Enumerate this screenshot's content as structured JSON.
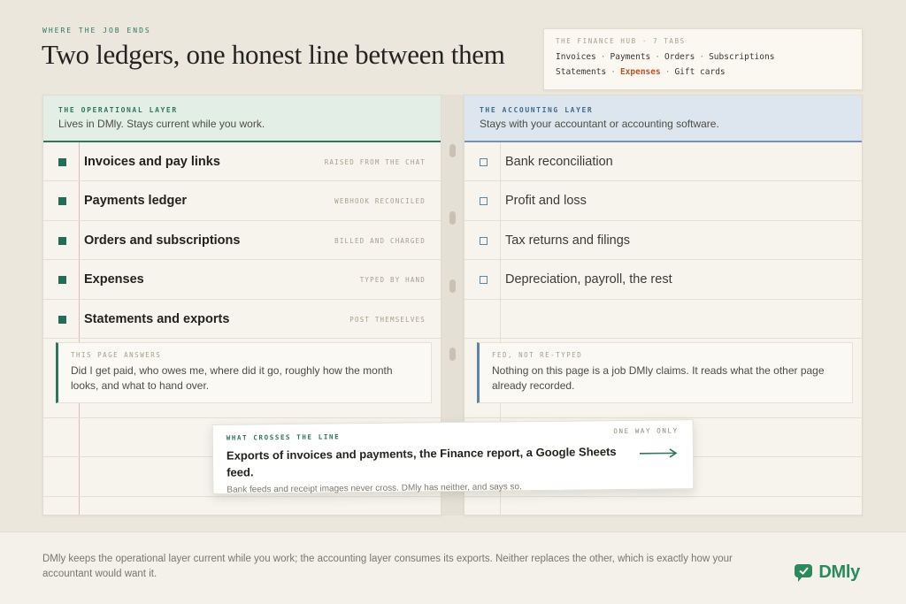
{
  "eyebrow": "WHERE THE JOB ENDS",
  "title": "Two ledgers, one honest line between them",
  "hub": {
    "label": "THE FINANCE HUB · 7 TABS",
    "row1": [
      "Invoices",
      "Payments",
      "Orders",
      "Subscriptions"
    ],
    "row2": [
      "Statements",
      "Expenses",
      "Gift cards"
    ],
    "active_tab": "Expenses",
    "separator": "·"
  },
  "operational": {
    "label": "THE OPERATIONAL LAYER",
    "subtitle": "Lives in DMly. Stays current while you work.",
    "items": [
      {
        "label": "Invoices and pay links",
        "tag": "RAISED FROM THE CHAT"
      },
      {
        "label": "Payments ledger",
        "tag": "WEBHOOK RECONCILED"
      },
      {
        "label": "Orders and subscriptions",
        "tag": "BILLED AND CHARGED"
      },
      {
        "label": "Expenses",
        "tag": "TYPED BY HAND"
      },
      {
        "label": "Statements and exports",
        "tag": "POST THEMSELVES"
      }
    ],
    "note": {
      "label": "THIS PAGE ANSWERS",
      "text": "Did I get paid, who owes me, where did it go, roughly how the month looks, and what to hand over."
    }
  },
  "accounting": {
    "label": "THE ACCOUNTING LAYER",
    "subtitle": "Stays with your accountant or accounting software.",
    "items": [
      {
        "label": "Bank reconciliation"
      },
      {
        "label": "Profit and loss"
      },
      {
        "label": "Tax returns and filings"
      },
      {
        "label": "Depreciation, payroll, the rest"
      }
    ],
    "note": {
      "label": "FED, NOT RE-TYPED",
      "text": "Nothing on this page is a job DMly claims. It reads what the other page already recorded."
    }
  },
  "crossing": {
    "label": "WHAT CROSSES THE LINE",
    "tag": "ONE WAY ONLY",
    "main": "Exports of invoices and payments, the Finance report, a Google Sheets feed.",
    "sub": "Bank feeds and receipt images never cross. DMly has neither, and says so."
  },
  "footer": {
    "text": "DMly keeps the operational layer current while you work; the accounting layer consumes its exports. Neither replaces the other, which is exactly how your accountant would want it.",
    "logo_text": "DMly"
  },
  "colors": {
    "operational_accent": "#2f7660",
    "accounting_accent": "#5e84a8",
    "active_tab": "#b4552e",
    "logo": "#2b8a5c"
  },
  "icons": {
    "arrow": "arrow-right-icon",
    "logo": "dmly-logo-icon"
  }
}
